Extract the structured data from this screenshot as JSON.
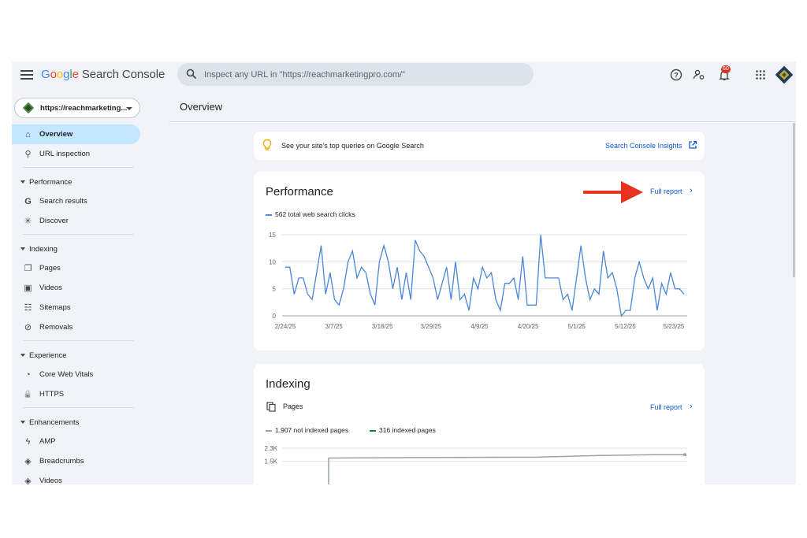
{
  "header": {
    "logo_letters": [
      "G",
      "o",
      "o",
      "g",
      "l",
      "e"
    ],
    "logo_rest": " Search Console",
    "search_placeholder": "Inspect any URL in \"https://reachmarketingpro.com/\"",
    "notification_count": "60"
  },
  "property": {
    "label": "https://reachmarketing..."
  },
  "page_title": "Overview",
  "sidebar": {
    "items": [
      {
        "type": "item",
        "label": "Overview",
        "icon": "home-icon",
        "active": true
      },
      {
        "type": "item",
        "label": "URL inspection",
        "icon": "search-icon"
      },
      {
        "type": "divider"
      },
      {
        "type": "section",
        "label": "Performance"
      },
      {
        "type": "item",
        "label": "Search results",
        "icon": "google-g-icon"
      },
      {
        "type": "item",
        "label": "Discover",
        "icon": "asterisk-icon"
      },
      {
        "type": "divider"
      },
      {
        "type": "section",
        "label": "Indexing"
      },
      {
        "type": "item",
        "label": "Pages",
        "icon": "pages-icon"
      },
      {
        "type": "item",
        "label": "Videos",
        "icon": "video-icon"
      },
      {
        "type": "item",
        "label": "Sitemaps",
        "icon": "sitemap-icon"
      },
      {
        "type": "item",
        "label": "Removals",
        "icon": "removal-icon"
      },
      {
        "type": "divider"
      },
      {
        "type": "section",
        "label": "Experience"
      },
      {
        "type": "item",
        "label": "Core Web Vitals",
        "icon": "gauge-icon"
      },
      {
        "type": "item",
        "label": "HTTPS",
        "icon": "lock-icon"
      },
      {
        "type": "divider"
      },
      {
        "type": "section",
        "label": "Enhancements"
      },
      {
        "type": "item",
        "label": "AMP",
        "icon": "bolt-icon"
      },
      {
        "type": "item",
        "label": "Breadcrumbs",
        "icon": "layers-icon"
      },
      {
        "type": "item",
        "label": "Videos",
        "icon": "layers-icon"
      }
    ]
  },
  "insights": {
    "text": "See your site's top queries on Google Search",
    "link": "Search Console Insights"
  },
  "performance": {
    "title": "Performance",
    "full_report": "Full report",
    "legend": "562 total web search clicks",
    "series_color": "#4a86d8"
  },
  "indexing": {
    "title": "Indexing",
    "pages_label": "Pages",
    "full_report": "Full report",
    "legend_not_indexed": "1,907 not indexed pages",
    "legend_indexed": "316 indexed pages",
    "not_indexed_color": "#9aa0a6",
    "indexed_color": "#188038"
  },
  "chart_data": [
    {
      "type": "line",
      "name": "Performance",
      "series": [
        {
          "name": "562 total web search clicks",
          "values": [
            9,
            9,
            4,
            7,
            7,
            4,
            3,
            8,
            13,
            4,
            8,
            3,
            2,
            5,
            10,
            12,
            7,
            9,
            8,
            4,
            2,
            10,
            13,
            10,
            5,
            9,
            3,
            8,
            3,
            14,
            12,
            11,
            9,
            7,
            3,
            6,
            9,
            3,
            10,
            3,
            4,
            1,
            7,
            5,
            9,
            7,
            8,
            3,
            1,
            6,
            6,
            7,
            3,
            11,
            2,
            2,
            2,
            15,
            7,
            7,
            7,
            7,
            3,
            4,
            1,
            7,
            13,
            7,
            3,
            5,
            4,
            12,
            7,
            8,
            5,
            0,
            1,
            1,
            7,
            10,
            7,
            5,
            7,
            1,
            6,
            4,
            8,
            5,
            5,
            4
          ]
        }
      ],
      "x_tick_labels": [
        "2/24/25",
        "3/7/25",
        "3/18/25",
        "3/29/25",
        "4/9/25",
        "4/20/25",
        "5/1/25",
        "5/12/25",
        "5/23/25"
      ],
      "y_ticks": [
        0,
        5,
        10,
        15
      ],
      "ylim": [
        0,
        15
      ]
    },
    {
      "type": "line",
      "name": "Indexing",
      "series": [
        {
          "name": "1,907 not indexed pages",
          "values": [
            1700,
            1710,
            1720,
            1730,
            1740,
            1745,
            1750,
            1755,
            1800,
            1850,
            1880,
            1900,
            1907
          ]
        }
      ],
      "y_tick_labels": [
        "2.3K",
        "1.5K"
      ],
      "ylim": [
        0,
        2300
      ]
    }
  ]
}
